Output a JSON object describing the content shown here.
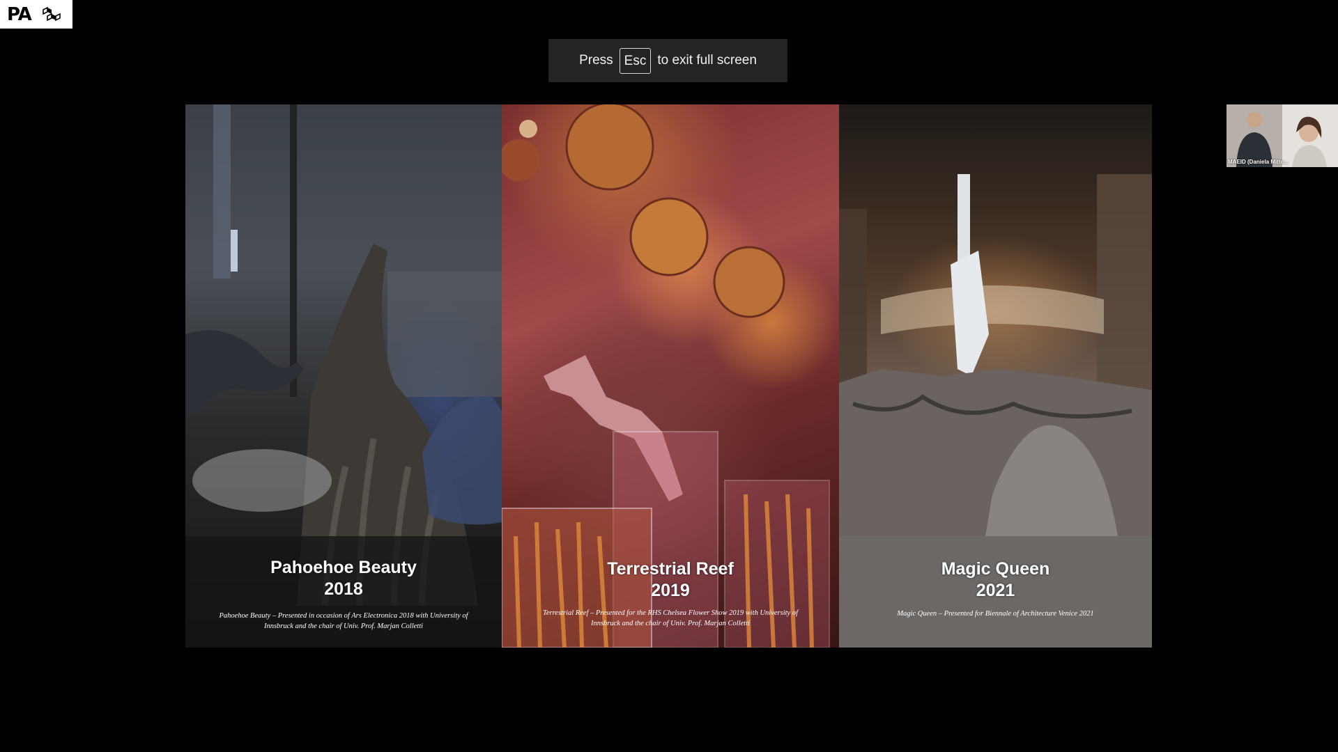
{
  "app": {
    "logo_text": "PA",
    "logo_icon": "cube-logo-icon"
  },
  "fullscreen_banner": {
    "press": "Press",
    "key": "Esc",
    "rest": "to exit full screen"
  },
  "slides": [
    {
      "title_line1": "Pahoehoe Beauty",
      "title_line2": "2018",
      "caption_line1": "Pahoehoe Beauty – Presented in occasion of Ars Electronica 2018 with University of",
      "caption_line2": "Innsbruck and the chair of Univ. Prof. Marjan Colletti"
    },
    {
      "title_line1": "Terrestrial Reef",
      "title_line2": "2019",
      "caption_line1": "Terrestrial Reef – Presented for the RHS Chelsea Flower Show 2019 with University of",
      "caption_line2": "Innsbruck and the chair of Univ. Prof. Marjan Colletti"
    },
    {
      "title_line1": "Magic Queen",
      "title_line2": "2021",
      "caption_line1": "Magic Queen – Presented for Biennale of Architecture Venice 2021",
      "caption_line2": ""
    }
  ],
  "participant": {
    "name": "MAEID (Daniela Mitte..."
  }
}
